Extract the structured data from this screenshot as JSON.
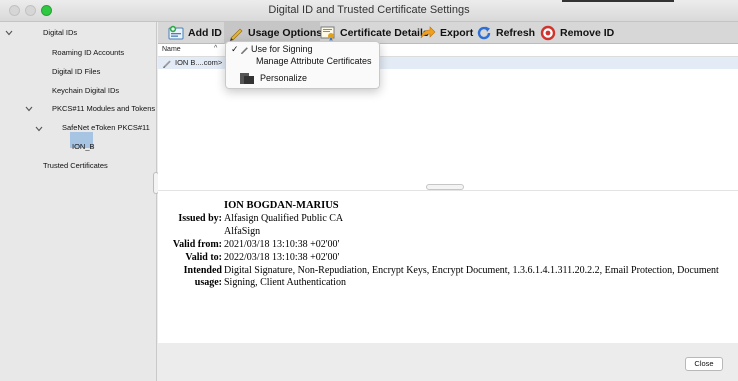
{
  "window": {
    "title": "Digital ID and Trusted Certificate Settings"
  },
  "sidebar": {
    "items": [
      {
        "label": "Digital IDs",
        "expanded": true
      },
      {
        "label": "Roaming ID Accounts"
      },
      {
        "label": "Digital ID Files"
      },
      {
        "label": "Keychain Digital IDs"
      },
      {
        "label": "PKCS#11 Modules and Tokens",
        "expanded": true
      },
      {
        "label": "SafeNet eToken PKCS#11",
        "expanded": true
      },
      {
        "label": "ION_B",
        "selected": true
      },
      {
        "label": "Trusted Certificates"
      }
    ]
  },
  "toolbar": {
    "add_id": "Add ID",
    "usage_options": "Usage Options",
    "certificate_details": "Certificate Details",
    "export": "Export",
    "refresh": "Refresh",
    "remove_id": "Remove ID"
  },
  "usage_menu": {
    "use_for_signing": "Use for Signing",
    "use_for_signing_checked": true,
    "manage_attribute_certificates": "Manage Attribute Certificates",
    "personalize": "Personalize"
  },
  "list": {
    "header_name": "Name",
    "rows": [
      {
        "name": "ION B....com>"
      }
    ]
  },
  "details": {
    "name": "ION BOGDAN-MARIUS",
    "issued_by_label": "Issued by:",
    "issued_by_line1": "Alfasign Qualified Public CA",
    "issued_by_line2": "AlfaSign",
    "valid_from_label": "Valid from:",
    "valid_from": "2021/03/18 13:10:38 +02'00'",
    "valid_to_label": "Valid to:",
    "valid_to": "2022/03/18 13:10:38 +02'00'",
    "intended_usage_label_1": "Intended",
    "intended_usage_label_2": "usage:",
    "intended_usage_line1": "Digital Signature, Non-Repudiation, Encrypt Keys, Encrypt Document, 1.3.6.1.4.1.311.20.2.2, Email Protection, Document",
    "intended_usage_line2": "Signing, Client Authentication"
  },
  "footer": {
    "close": "Close"
  },
  "icons": {
    "add_id": "add-id-icon",
    "usage_options": "pencil-icon",
    "certificate_details": "certificate-icon",
    "export": "export-arrow-icon",
    "refresh": "refresh-icon",
    "remove_id": "remove-icon",
    "personalize": "personalize-icon"
  },
  "colors": {
    "selection": "#a7c4e2",
    "list_row_highlight": "#e3ebf6",
    "export_arrow": "#f0a01e",
    "refresh": "#2d6fd6",
    "remove": "#d0342c",
    "traffic_green": "#2fc840"
  }
}
